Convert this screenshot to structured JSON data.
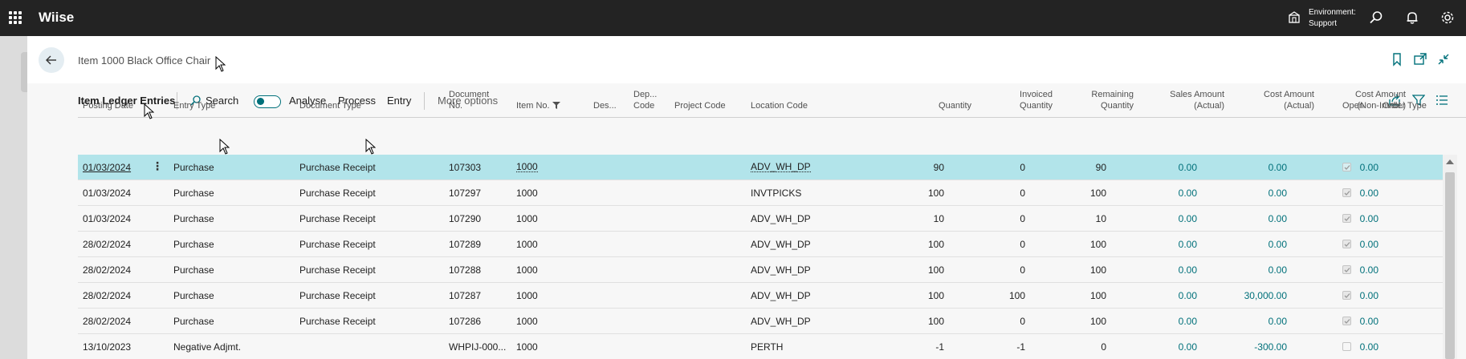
{
  "app": {
    "brand": "Wiise",
    "environment_label": "Environment:",
    "environment_value": "Support"
  },
  "page": {
    "title": "Item 1000 Black Office Chair"
  },
  "actions": {
    "page_name": "Item Ledger Entries",
    "search": "Search",
    "analyse": "Analyse",
    "process": "Process",
    "entry": "Entry",
    "more": "More options"
  },
  "columns": {
    "posting_date": "Posting Date",
    "entry_type": "Entry Type",
    "document_type": "Document Type",
    "document_no_1": "Document",
    "document_no_2": "No.",
    "item_no": "Item No.",
    "description": "Des...",
    "dept_code_1": "Dep...",
    "dept_code_2": "Code",
    "project_code": "Project Code",
    "location_code": "Location Code",
    "quantity": "Quantity",
    "invoiced_1": "Invoiced",
    "invoiced_2": "Quantity",
    "remaining_1": "Remaining",
    "remaining_2": "Quantity",
    "sales_1": "Sales Amount",
    "sales_2": "(Actual)",
    "cost_1": "Cost Amount",
    "cost_2": "(Actual)",
    "costni_1": "Cost Amount",
    "costni_2": "(Non-Invtbl.)",
    "open": "Open",
    "order_type": "Order Type"
  },
  "rows": [
    {
      "posting_date": "01/03/2024",
      "entry_type": "Purchase",
      "document_type": "Purchase Receipt",
      "document_no": "107303",
      "item_no": "1000",
      "location": "ADV_WH_DP",
      "quantity": "90",
      "invoiced": "0",
      "remaining": "90",
      "sales": "0.00",
      "cost": "0.00",
      "cost_ni": "0.00",
      "open": true
    },
    {
      "posting_date": "01/03/2024",
      "entry_type": "Purchase",
      "document_type": "Purchase Receipt",
      "document_no": "107297",
      "item_no": "1000",
      "location": "INVTPICKS",
      "quantity": "100",
      "invoiced": "0",
      "remaining": "100",
      "sales": "0.00",
      "cost": "0.00",
      "cost_ni": "0.00",
      "open": true
    },
    {
      "posting_date": "01/03/2024",
      "entry_type": "Purchase",
      "document_type": "Purchase Receipt",
      "document_no": "107290",
      "item_no": "1000",
      "location": "ADV_WH_DP",
      "quantity": "10",
      "invoiced": "0",
      "remaining": "10",
      "sales": "0.00",
      "cost": "0.00",
      "cost_ni": "0.00",
      "open": true
    },
    {
      "posting_date": "28/02/2024",
      "entry_type": "Purchase",
      "document_type": "Purchase Receipt",
      "document_no": "107289",
      "item_no": "1000",
      "location": "ADV_WH_DP",
      "quantity": "100",
      "invoiced": "0",
      "remaining": "100",
      "sales": "0.00",
      "cost": "0.00",
      "cost_ni": "0.00",
      "open": true
    },
    {
      "posting_date": "28/02/2024",
      "entry_type": "Purchase",
      "document_type": "Purchase Receipt",
      "document_no": "107288",
      "item_no": "1000",
      "location": "ADV_WH_DP",
      "quantity": "100",
      "invoiced": "0",
      "remaining": "100",
      "sales": "0.00",
      "cost": "0.00",
      "cost_ni": "0.00",
      "open": true
    },
    {
      "posting_date": "28/02/2024",
      "entry_type": "Purchase",
      "document_type": "Purchase Receipt",
      "document_no": "107287",
      "item_no": "1000",
      "location": "ADV_WH_DP",
      "quantity": "100",
      "invoiced": "100",
      "remaining": "100",
      "sales": "0.00",
      "cost": "30,000.00",
      "cost_ni": "0.00",
      "open": true
    },
    {
      "posting_date": "28/02/2024",
      "entry_type": "Purchase",
      "document_type": "Purchase Receipt",
      "document_no": "107286",
      "item_no": "1000",
      "location": "ADV_WH_DP",
      "quantity": "100",
      "invoiced": "0",
      "remaining": "100",
      "sales": "0.00",
      "cost": "0.00",
      "cost_ni": "0.00",
      "open": true
    },
    {
      "posting_date": "13/10/2023",
      "entry_type": "Negative Adjmt.",
      "document_type": "",
      "document_no": "WHPIJ-000...",
      "item_no": "1000",
      "location": "PERTH",
      "quantity": "-1",
      "invoiced": "-1",
      "remaining": "0",
      "sales": "0.00",
      "cost": "-300.00",
      "cost_ni": "0.00",
      "open": false
    }
  ],
  "colors": {
    "appbar": "#232323",
    "accent": "#00707a",
    "selected_row": "#b2e4ea"
  }
}
